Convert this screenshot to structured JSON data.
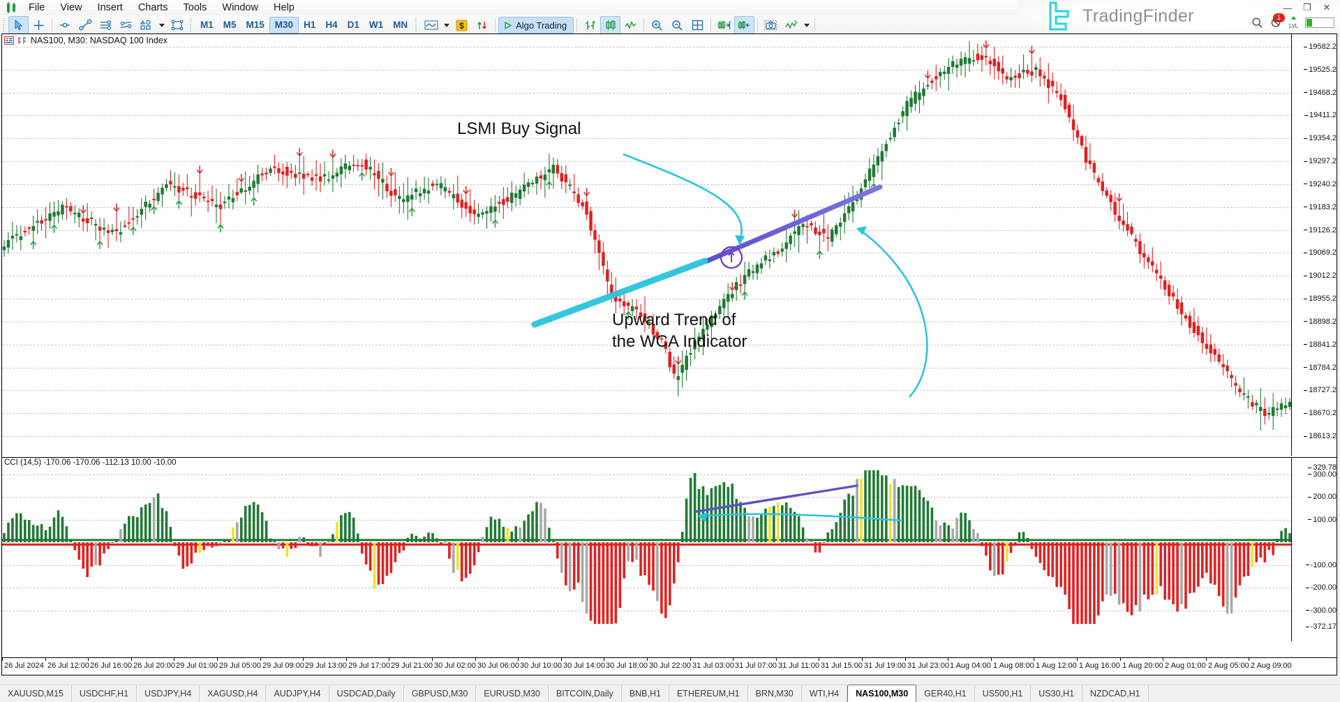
{
  "app": {
    "name": "MetaTrader 5",
    "brand": "TradingFinder"
  },
  "menu": {
    "items": [
      "File",
      "View",
      "Insert",
      "Charts",
      "Tools",
      "Window",
      "Help"
    ]
  },
  "toolbar": {
    "cursor_tools": [
      {
        "name": "cursor-tool",
        "label": "Cursor"
      },
      {
        "name": "crosshair-tool",
        "label": "Crosshair"
      }
    ],
    "line_tools": [
      {
        "name": "vertical-line-tool",
        "label": "Vertical Line"
      },
      {
        "name": "trendline-tool",
        "label": "Trendline"
      },
      {
        "name": "equidistant-channel-tool",
        "label": "Equidistant Channel"
      },
      {
        "name": "fibonacci-tool",
        "label": "Fibonacci"
      },
      {
        "name": "shapes-tool",
        "label": "Shapes"
      },
      {
        "name": "objects-tool",
        "label": "Objects"
      }
    ],
    "timeframes": [
      "M1",
      "M5",
      "M15",
      "M30",
      "H1",
      "H4",
      "D1",
      "W1",
      "MN"
    ],
    "active_timeframe": "M30",
    "algo_trading_label": "Algo Trading",
    "chart_type_buttons": [
      {
        "name": "bar-chart-button",
        "label": "Bar Chart"
      },
      {
        "name": "candlestick-chart-button",
        "label": "Candlesticks",
        "active": true
      },
      {
        "name": "line-chart-button",
        "label": "Line Chart"
      }
    ],
    "zoom_in_label": "Zoom In",
    "zoom_out_label": "Zoom Out",
    "grid_label": "Grid",
    "shift_end_label": "Shift End",
    "auto_scroll_label": "Auto Scroll",
    "screenshot_label": "Screenshot",
    "indicators_label": "Indicators"
  },
  "window_controls": {
    "minimize": "—",
    "restore": "❐",
    "close": "✕"
  },
  "status": {
    "search_label": "Search",
    "notifications_label": "Notifications",
    "notifications_count": "1",
    "level_label": "LVL",
    "connection_label": "Connection"
  },
  "chart": {
    "title": "NAS100, M30: NASDAQ 100 Index",
    "symbol": "NAS100",
    "timeframe": "M30",
    "description": "NASDAQ 100 Index"
  },
  "annotations": [
    {
      "id": "lsmi-buy-signal",
      "text": "LSMI Buy Signal"
    },
    {
      "id": "wca-upward-trend",
      "line1": "Upward Trend of",
      "line2": "the WCA Indicator"
    }
  ],
  "indicator": {
    "label": "CCI (14,5) -170.06 -170.06 -112.13 10.00 -10.00",
    "name": "CCI",
    "params": "(14,5)",
    "values": [
      "-170.06",
      "-170.06",
      "-112.13",
      "10.00",
      "-10.00"
    ]
  },
  "colors": {
    "bull": "#1f7a34",
    "bear": "#e22020",
    "annotation_arrow": "#2bc4dd",
    "wca_line_price": "#6a5bd6",
    "wca_line_indicator": "#5b52c8",
    "signal_circle": "#7b3fbf",
    "cci_positive": "#1f7a34",
    "cci_negative": "#e22020",
    "cci_neutral": "#a8a8a8",
    "cci_warn": "#f2e324",
    "brand": "#2bd4e8",
    "grid": "#c9c9c9"
  },
  "chart_data": {
    "type": "candlestick",
    "title": "NAS100, M30: NASDAQ 100 Index",
    "price_ticks": [
      "19582.2",
      "19525.2",
      "19468.2",
      "19411.2",
      "19354.2",
      "19297.2",
      "19240.2",
      "19183.2",
      "19126.2",
      "19069.2",
      "19012.2",
      "18955.2",
      "18898.2",
      "18841.2",
      "18784.2",
      "18727.2",
      "18670.2",
      "18613.2"
    ],
    "price_range": [
      18613.2,
      19582.2
    ],
    "time_ticks": [
      "26 Jul 2024",
      "26 Jul 12:00",
      "26 Jul 16:00",
      "26 Jul 20:00",
      "29 Jul 01:00",
      "29 Jul 05:00",
      "29 Jul 09:00",
      "29 Jul 13:00",
      "29 Jul 17:00",
      "29 Jul 21:00",
      "30 Jul 02:00",
      "30 Jul 06:00",
      "30 Jul 10:00",
      "30 Jul 14:00",
      "30 Jul 18:00",
      "30 Jul 22:00",
      "31 Jul 03:00",
      "31 Jul 07:00",
      "31 Jul 11:00",
      "31 Jul 15:00",
      "31 Jul 19:00",
      "31 Jul 23:00",
      "1 Aug 04:00",
      "1 Aug 08:00",
      "1 Aug 12:00",
      "1 Aug 16:00",
      "1 Aug 20:00",
      "2 Aug 01:00",
      "2 Aug 05:00",
      "2 Aug 09:00"
    ],
    "indicator_ticks": [
      "329.78",
      "300.00",
      "200.00",
      "100.00",
      "-100.00",
      "-200.00",
      "-300.00",
      "-372.17"
    ],
    "indicator_range": [
      -372.17,
      329.78
    ],
    "indicator_levels": [
      10.0,
      -10.0
    ]
  },
  "tabs": {
    "items": [
      {
        "label": "XAUUSD,M15",
        "active": false
      },
      {
        "label": "USDCHF,H1",
        "active": false
      },
      {
        "label": "USDJPY,H4",
        "active": false
      },
      {
        "label": "XAGUSD,H4",
        "active": false
      },
      {
        "label": "AUDJPY,H4",
        "active": false
      },
      {
        "label": "USDCAD,Daily",
        "active": false
      },
      {
        "label": "GBPUSD,M30",
        "active": false
      },
      {
        "label": "EURUSD,M30",
        "active": false
      },
      {
        "label": "BITCOIN,Daily",
        "active": false
      },
      {
        "label": "BNB,H1",
        "active": false
      },
      {
        "label": "ETHEREUM,H1",
        "active": false
      },
      {
        "label": "BRN,M30",
        "active": false
      },
      {
        "label": "WTI,H4",
        "active": false
      },
      {
        "label": "NAS100,M30",
        "active": true
      },
      {
        "label": "GER40,H1",
        "active": false
      },
      {
        "label": "US500,H1",
        "active": false
      },
      {
        "label": "US30,H1",
        "active": false
      },
      {
        "label": "NZDCAD,H1",
        "active": false
      }
    ]
  }
}
